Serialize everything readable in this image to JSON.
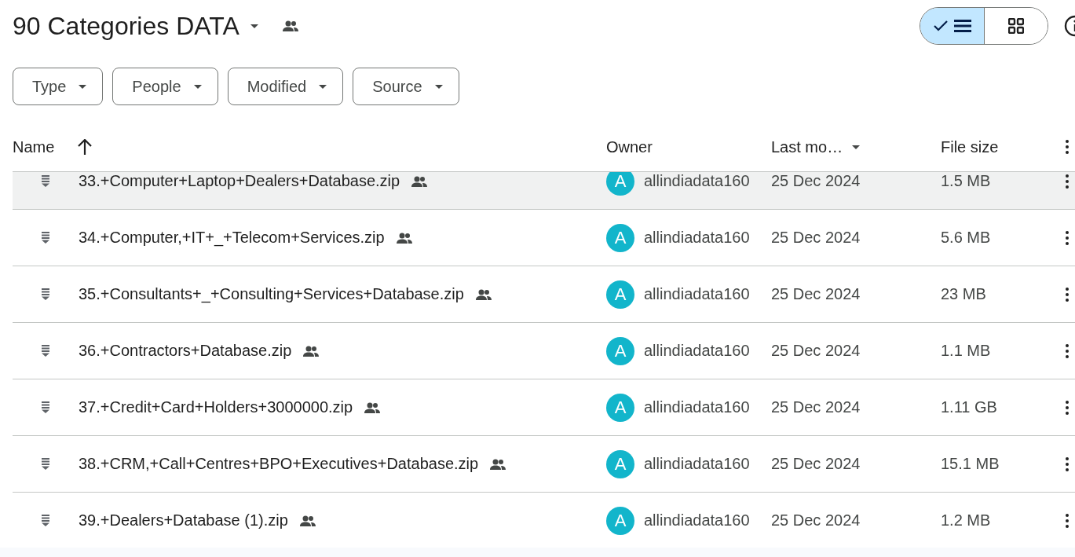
{
  "header": {
    "title": "90 Categories DATA",
    "view_toggle": [
      {
        "kind": "list",
        "selected": true
      },
      {
        "kind": "grid",
        "selected": false
      }
    ]
  },
  "filters": [
    {
      "label": "Type"
    },
    {
      "label": "People"
    },
    {
      "label": "Modified"
    },
    {
      "label": "Source"
    }
  ],
  "table": {
    "columns": [
      "Name",
      "Owner",
      "Last mo…",
      "File size"
    ],
    "rows": [
      {
        "name": "33.+Computer+Laptop+Dealers+Database.zip",
        "owner_initial": "A",
        "owner": "allindiadata160",
        "modified": "25 Dec 2024",
        "size": "1.5 MB",
        "selected": true
      },
      {
        "name": "34.+Computer,+IT+_+Telecom+Services.zip",
        "owner_initial": "A",
        "owner": "allindiadata160",
        "modified": "25 Dec 2024",
        "size": "5.6 MB",
        "selected": false
      },
      {
        "name": "35.+Consultants+_+Consulting+Services+Database.zip",
        "owner_initial": "A",
        "owner": "allindiadata160",
        "modified": "25 Dec 2024",
        "size": "23 MB",
        "selected": false
      },
      {
        "name": "36.+Contractors+Database.zip",
        "owner_initial": "A",
        "owner": "allindiadata160",
        "modified": "25 Dec 2024",
        "size": "1.1 MB",
        "selected": false
      },
      {
        "name": "37.+Credit+Card+Holders+3000000.zip",
        "owner_initial": "A",
        "owner": "allindiadata160",
        "modified": "25 Dec 2024",
        "size": "1.11 GB",
        "selected": false
      },
      {
        "name": "38.+CRM,+Call+Centres+BPO+Executives+Database.zip",
        "owner_initial": "A",
        "owner": "allindiadata160",
        "modified": "25 Dec 2024",
        "size": "15.1 MB",
        "selected": false
      },
      {
        "name": "39.+Dealers+Database (1).zip",
        "owner_initial": "A",
        "owner": "allindiadata160",
        "modified": "25 Dec 2024",
        "size": "1.2 MB",
        "selected": false
      }
    ]
  }
}
